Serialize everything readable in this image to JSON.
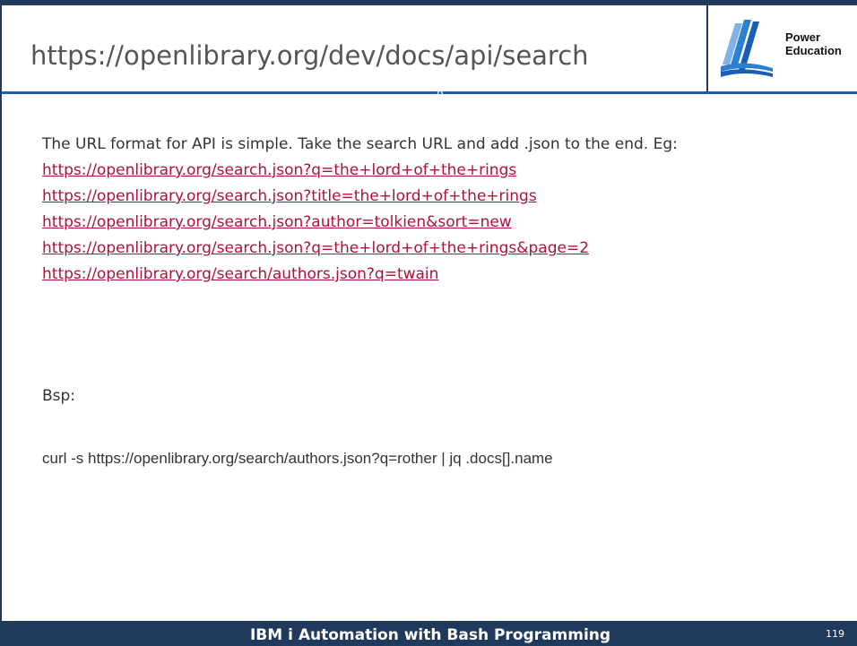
{
  "header": {
    "title": "https://openlibrary.org/dev/docs/api/search",
    "title_overflow": "0"
  },
  "logo": {
    "line1": "Power",
    "line2": "Education",
    "icon": "power-education-logo"
  },
  "content": {
    "intro": "The URL format for API is simple. Take the search URL and add .json to the end. Eg:",
    "links": [
      "https://openlibrary.org/search.json?q=the+lord+of+the+rings",
      "https://openlibrary.org/search.json?title=the+lord+of+the+rings",
      "https://openlibrary.org/search.json?author=tolkien&sort=new",
      "https://openlibrary.org/search.json?q=the+lord+of+the+rings&page=2",
      "https://openlibrary.org/search/authors.json?q=twain"
    ],
    "example_label": "Bsp:",
    "command": "curl -s https://openlibrary.org/search/authors.json?q=rother | jq .docs[].name"
  },
  "footer": {
    "title": "IBM i Automation with Bash Programming",
    "page_number": "119"
  },
  "colors": {
    "brand_dark": "#1f3a5c",
    "accent_blue": "#1a5fb4",
    "link": "#b0113a",
    "text": "#333333"
  }
}
